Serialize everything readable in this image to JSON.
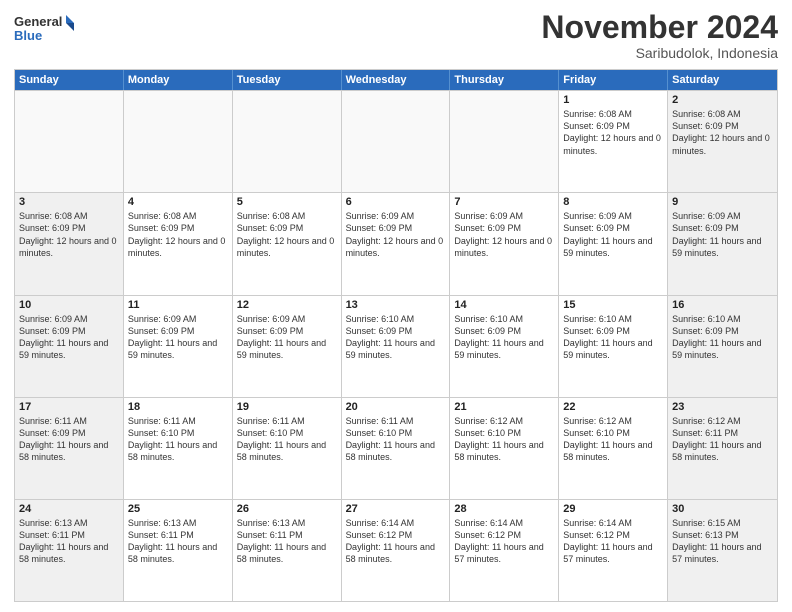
{
  "logo": {
    "line1": "General",
    "line2": "Blue"
  },
  "header": {
    "month": "November 2024",
    "location": "Saribudolok, Indonesia"
  },
  "days": [
    "Sunday",
    "Monday",
    "Tuesday",
    "Wednesday",
    "Thursday",
    "Friday",
    "Saturday"
  ],
  "rows": [
    [
      {
        "day": "",
        "text": ""
      },
      {
        "day": "",
        "text": ""
      },
      {
        "day": "",
        "text": ""
      },
      {
        "day": "",
        "text": ""
      },
      {
        "day": "",
        "text": ""
      },
      {
        "day": "1",
        "text": "Sunrise: 6:08 AM\nSunset: 6:09 PM\nDaylight: 12 hours and 0 minutes."
      },
      {
        "day": "2",
        "text": "Sunrise: 6:08 AM\nSunset: 6:09 PM\nDaylight: 12 hours and 0 minutes."
      }
    ],
    [
      {
        "day": "3",
        "text": "Sunrise: 6:08 AM\nSunset: 6:09 PM\nDaylight: 12 hours and 0 minutes."
      },
      {
        "day": "4",
        "text": "Sunrise: 6:08 AM\nSunset: 6:09 PM\nDaylight: 12 hours and 0 minutes."
      },
      {
        "day": "5",
        "text": "Sunrise: 6:08 AM\nSunset: 6:09 PM\nDaylight: 12 hours and 0 minutes."
      },
      {
        "day": "6",
        "text": "Sunrise: 6:09 AM\nSunset: 6:09 PM\nDaylight: 12 hours and 0 minutes."
      },
      {
        "day": "7",
        "text": "Sunrise: 6:09 AM\nSunset: 6:09 PM\nDaylight: 12 hours and 0 minutes."
      },
      {
        "day": "8",
        "text": "Sunrise: 6:09 AM\nSunset: 6:09 PM\nDaylight: 11 hours and 59 minutes."
      },
      {
        "day": "9",
        "text": "Sunrise: 6:09 AM\nSunset: 6:09 PM\nDaylight: 11 hours and 59 minutes."
      }
    ],
    [
      {
        "day": "10",
        "text": "Sunrise: 6:09 AM\nSunset: 6:09 PM\nDaylight: 11 hours and 59 minutes."
      },
      {
        "day": "11",
        "text": "Sunrise: 6:09 AM\nSunset: 6:09 PM\nDaylight: 11 hours and 59 minutes."
      },
      {
        "day": "12",
        "text": "Sunrise: 6:09 AM\nSunset: 6:09 PM\nDaylight: 11 hours and 59 minutes."
      },
      {
        "day": "13",
        "text": "Sunrise: 6:10 AM\nSunset: 6:09 PM\nDaylight: 11 hours and 59 minutes."
      },
      {
        "day": "14",
        "text": "Sunrise: 6:10 AM\nSunset: 6:09 PM\nDaylight: 11 hours and 59 minutes."
      },
      {
        "day": "15",
        "text": "Sunrise: 6:10 AM\nSunset: 6:09 PM\nDaylight: 11 hours and 59 minutes."
      },
      {
        "day": "16",
        "text": "Sunrise: 6:10 AM\nSunset: 6:09 PM\nDaylight: 11 hours and 59 minutes."
      }
    ],
    [
      {
        "day": "17",
        "text": "Sunrise: 6:11 AM\nSunset: 6:09 PM\nDaylight: 11 hours and 58 minutes."
      },
      {
        "day": "18",
        "text": "Sunrise: 6:11 AM\nSunset: 6:10 PM\nDaylight: 11 hours and 58 minutes."
      },
      {
        "day": "19",
        "text": "Sunrise: 6:11 AM\nSunset: 6:10 PM\nDaylight: 11 hours and 58 minutes."
      },
      {
        "day": "20",
        "text": "Sunrise: 6:11 AM\nSunset: 6:10 PM\nDaylight: 11 hours and 58 minutes."
      },
      {
        "day": "21",
        "text": "Sunrise: 6:12 AM\nSunset: 6:10 PM\nDaylight: 11 hours and 58 minutes."
      },
      {
        "day": "22",
        "text": "Sunrise: 6:12 AM\nSunset: 6:10 PM\nDaylight: 11 hours and 58 minutes."
      },
      {
        "day": "23",
        "text": "Sunrise: 6:12 AM\nSunset: 6:11 PM\nDaylight: 11 hours and 58 minutes."
      }
    ],
    [
      {
        "day": "24",
        "text": "Sunrise: 6:13 AM\nSunset: 6:11 PM\nDaylight: 11 hours and 58 minutes."
      },
      {
        "day": "25",
        "text": "Sunrise: 6:13 AM\nSunset: 6:11 PM\nDaylight: 11 hours and 58 minutes."
      },
      {
        "day": "26",
        "text": "Sunrise: 6:13 AM\nSunset: 6:11 PM\nDaylight: 11 hours and 58 minutes."
      },
      {
        "day": "27",
        "text": "Sunrise: 6:14 AM\nSunset: 6:12 PM\nDaylight: 11 hours and 58 minutes."
      },
      {
        "day": "28",
        "text": "Sunrise: 6:14 AM\nSunset: 6:12 PM\nDaylight: 11 hours and 57 minutes."
      },
      {
        "day": "29",
        "text": "Sunrise: 6:14 AM\nSunset: 6:12 PM\nDaylight: 11 hours and 57 minutes."
      },
      {
        "day": "30",
        "text": "Sunrise: 6:15 AM\nSunset: 6:13 PM\nDaylight: 11 hours and 57 minutes."
      }
    ]
  ]
}
